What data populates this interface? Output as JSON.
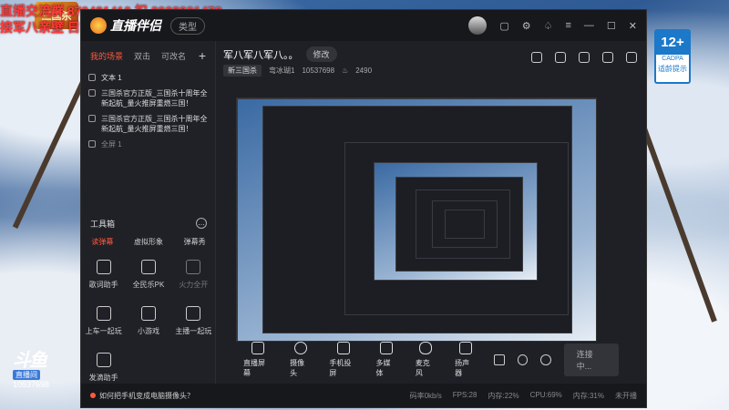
{
  "overlay": {
    "line1": "直播交流群 879481410 扣 2928821479",
    "line2": "接军八亲壁 日常活动"
  },
  "rating": {
    "age": "12+",
    "org": "CADPA",
    "tip": "适龄提示"
  },
  "watermark": {
    "logo": "斗鱼",
    "tag": "直播间",
    "room": "10537698"
  },
  "app": {
    "brand": "直播伴侣",
    "type_pill": "类型",
    "scenes": {
      "tabs": [
        "我的场景",
        "双击",
        "可改名"
      ],
      "sources": [
        {
          "label": "文本 1"
        },
        {
          "label": "三国杀官方正版_三国杀十周年全新起航_量火推屏重燃三国！"
        },
        {
          "label": "三国杀官方正版_三国杀十周年全新起航_量火推屏重燃三国！"
        },
        {
          "label": "全屏 1"
        }
      ]
    },
    "tools": {
      "title": "工具箱",
      "tabs": [
        "读弹幕",
        "虚拟形象",
        "弹幕秀"
      ],
      "items": [
        {
          "label": "歌词助手",
          "icon": "lyrics-icon",
          "dim": false
        },
        {
          "label": "全民乐PK",
          "icon": "pk-icon",
          "dim": false
        },
        {
          "label": "火力全开",
          "icon": "download-icon",
          "dim": true
        },
        {
          "label": "上车一起玩",
          "icon": "gamepad-icon",
          "dim": false
        },
        {
          "label": "小游戏",
          "icon": "mini-game-icon",
          "dim": false
        },
        {
          "label": "主播一起玩",
          "icon": "clipboard-icon",
          "dim": false
        },
        {
          "label": "发滴助手",
          "icon": "box-icon",
          "dim": false
        }
      ]
    },
    "stream": {
      "title": "军八军八军八。。",
      "edit_label": "修改",
      "category": "新三国杀",
      "host": "弯冰瑚1",
      "room_id": "10537698",
      "heat": "2490"
    },
    "bottom": {
      "items": [
        {
          "label": "直播屏幕",
          "icon": "screen-icon"
        },
        {
          "label": "摄像头",
          "icon": "camera-icon"
        },
        {
          "label": "手机投屏",
          "icon": "phone-cast-icon"
        },
        {
          "label": "多媒体",
          "icon": "media-icon"
        },
        {
          "label": "麦克风",
          "icon": "microphone-icon"
        },
        {
          "label": "扬声器",
          "icon": "speaker-icon"
        }
      ],
      "connect_label": "连接中..."
    },
    "status": {
      "camera_link": "如何把手机变成电脑摄像头？",
      "net": "码率0kb/s",
      "fps": "FPS:28",
      "mem": "内存:22%",
      "cpu": "CPU:69%",
      "gpu": "内存:31%",
      "state": "未开播"
    }
  }
}
